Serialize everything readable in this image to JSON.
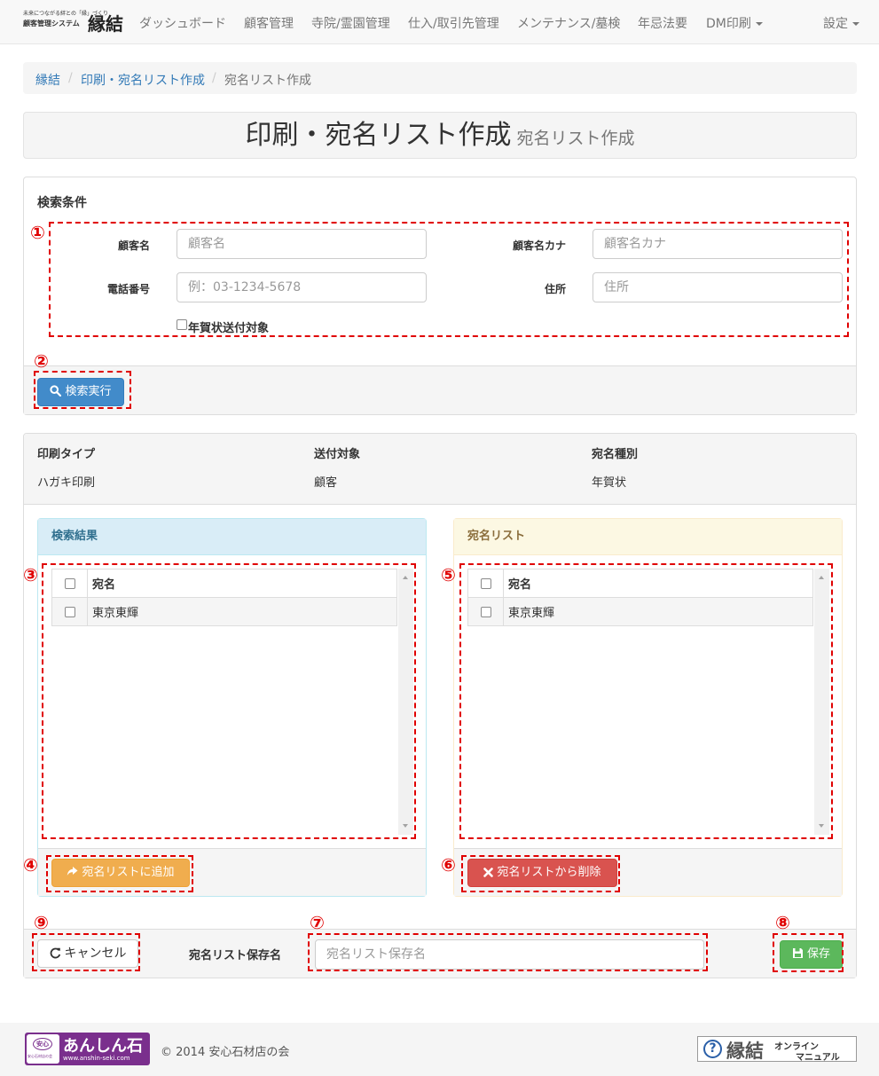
{
  "brand": {
    "tagline": "未来につながる絆との「縁」づくり",
    "system": "顧客管理システム",
    "name": "縁結"
  },
  "nav": {
    "items": [
      "ダッシュボード",
      "顧客管理",
      "寺院/霊園管理",
      "仕入/取引先管理",
      "メンテナンス/墓検",
      "年忌法要"
    ],
    "dm": "DM印刷",
    "settings": "設定"
  },
  "breadcrumb": {
    "root": "縁結",
    "parent": "印刷・宛名リスト作成",
    "current": "宛名リスト作成",
    "sep": "/"
  },
  "page": {
    "title": "印刷・宛名リスト作成",
    "subtitle": "宛名リスト作成"
  },
  "search": {
    "heading": "検索条件",
    "customer_name_label": "顧客名",
    "customer_name_placeholder": "顧客名",
    "kana_label": "顧客名カナ",
    "kana_placeholder": "顧客名カナ",
    "phone_label": "電話番号",
    "phone_placeholder": "例：03-1234-5678",
    "address_label": "住所",
    "address_placeholder": "住所",
    "nenga_label": "年賀状送付対象",
    "search_button": "検索実行"
  },
  "info": {
    "print_type_label": "印刷タイプ",
    "print_type_value": "ハガキ印刷",
    "target_label": "送付対象",
    "target_value": "顧客",
    "kind_label": "宛名種別",
    "kind_value": "年賀状"
  },
  "results": {
    "heading": "検索結果",
    "column": "宛名",
    "rows": [
      "東京東輝"
    ],
    "add_button": "宛名リストに追加"
  },
  "address_list": {
    "heading": "宛名リスト",
    "column": "宛名",
    "rows": [
      "東京東輝"
    ],
    "remove_button": "宛名リストから削除"
  },
  "save_bar": {
    "cancel_button": "キャンセル",
    "name_label": "宛名リスト保存名",
    "name_placeholder": "宛名リスト保存名",
    "save_button": "保存"
  },
  "annotations": [
    "①",
    "②",
    "③",
    "④",
    "⑤",
    "⑥",
    "⑦",
    "⑧",
    "⑨"
  ],
  "footer": {
    "logo_text": "あんしん石",
    "logo_url": "www.anshin-seki.com",
    "logo_badge": "安心",
    "logo_badge_sub": "安心石材店の会",
    "copyright": "© 2014 安心石材店の会",
    "manual_brand": "縁結",
    "manual_line1": "オンライン",
    "manual_line2": "マニュアル",
    "help_icon_glyph": "?"
  },
  "colors": {
    "primary": "#428bca",
    "warning": "#f0ad4e",
    "danger": "#d9534f",
    "success": "#5cb85c",
    "annotation": "#e00000",
    "info_header": "#d9edf7",
    "warning_header": "#fcf8e3",
    "logo_purple": "#7a2f8d"
  }
}
